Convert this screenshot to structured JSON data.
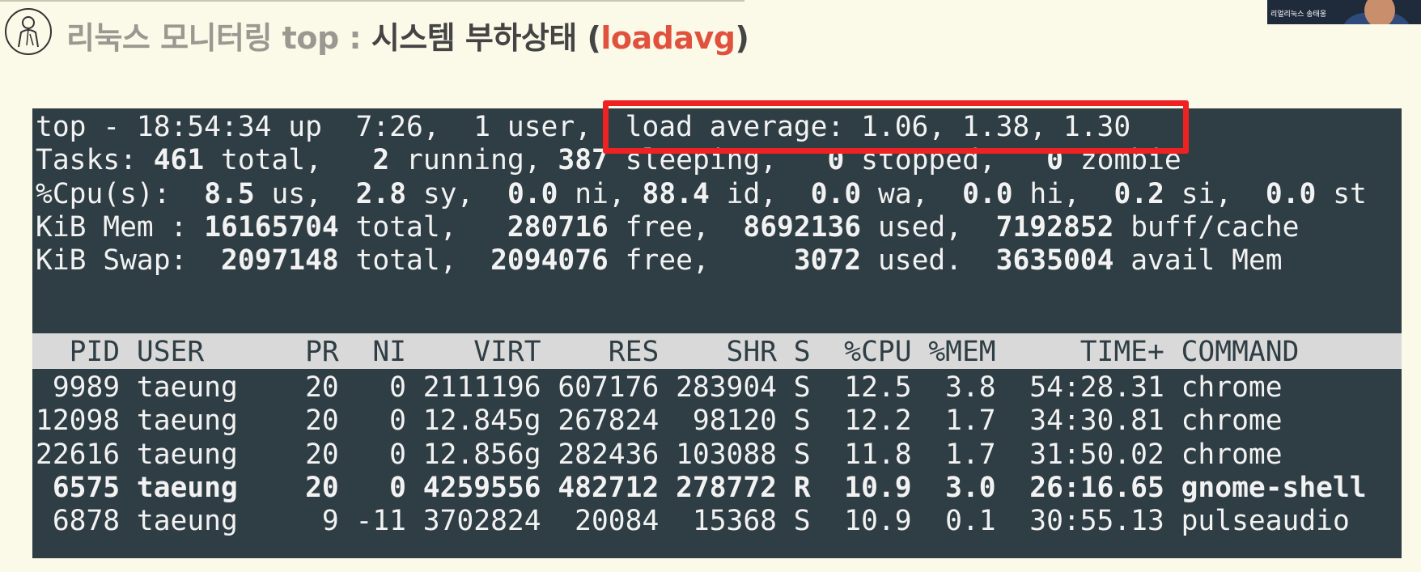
{
  "slide": {
    "title_gray": "리눅스 모니터링 top : ",
    "title_dark": "시스템 부하상태 (",
    "title_red": "loadavg",
    "title_close": ")"
  },
  "webcam": {
    "name": "리얼리눅스 송태웅"
  },
  "colors": {
    "terminal_bg": "#2f3e45",
    "highlight": "#ee2222",
    "accent": "#e0523e",
    "slide_bg": "#fbf9e8"
  },
  "terminal": {
    "summary": [
      [
        {
          "t": "top - 18:54:34 up  7:26,  1 user,  load average: 1.06, 1.38, 1.30"
        }
      ],
      [
        {
          "t": "Tasks: "
        },
        {
          "t": "461",
          "b": true
        },
        {
          "t": " total,   "
        },
        {
          "t": "2",
          "b": true
        },
        {
          "t": " running, "
        },
        {
          "t": "387",
          "b": true
        },
        {
          "t": " sleeping,   "
        },
        {
          "t": "0",
          "b": true
        },
        {
          "t": " stopped,   "
        },
        {
          "t": "0",
          "b": true
        },
        {
          "t": " zombie"
        }
      ],
      [
        {
          "t": "%Cpu(s):  "
        },
        {
          "t": "8.5",
          "b": true
        },
        {
          "t": " us,  "
        },
        {
          "t": "2.8",
          "b": true
        },
        {
          "t": " sy,  "
        },
        {
          "t": "0.0",
          "b": true
        },
        {
          "t": " ni, "
        },
        {
          "t": "88.4",
          "b": true
        },
        {
          "t": " id,  "
        },
        {
          "t": "0.0",
          "b": true
        },
        {
          "t": " wa,  "
        },
        {
          "t": "0.0",
          "b": true
        },
        {
          "t": " hi,  "
        },
        {
          "t": "0.2",
          "b": true
        },
        {
          "t": " si,  "
        },
        {
          "t": "0.0",
          "b": true
        },
        {
          "t": " st"
        }
      ],
      [
        {
          "t": "KiB Mem : "
        },
        {
          "t": "16165704",
          "b": true
        },
        {
          "t": " total,   "
        },
        {
          "t": "280716",
          "b": true
        },
        {
          "t": " free,  "
        },
        {
          "t": "8692136",
          "b": true
        },
        {
          "t": " used,  "
        },
        {
          "t": "7192852",
          "b": true
        },
        {
          "t": " buff/cache"
        }
      ],
      [
        {
          "t": "KiB Swap:  "
        },
        {
          "t": "2097148",
          "b": true
        },
        {
          "t": " total,  "
        },
        {
          "t": "2094076",
          "b": true
        },
        {
          "t": " free,     "
        },
        {
          "t": "3072",
          "b": true
        },
        {
          "t": " used.  "
        },
        {
          "t": "3635004",
          "b": true
        },
        {
          "t": " avail Mem"
        }
      ]
    ],
    "header": "  PID USER      PR  NI    VIRT    RES    SHR S  %CPU %MEM     TIME+ COMMAND",
    "processes": [
      {
        "text": " 9989 taeung    20   0 2111196 607176 283904 S  12.5  3.8  54:28.31 chrome",
        "bold": false
      },
      {
        "text": "12098 taeung    20   0 12.845g 267824  98120 S  12.2  1.7  34:30.81 chrome",
        "bold": false
      },
      {
        "text": "22616 taeung    20   0 12.856g 282436 103088 S  11.8  1.7  31:50.02 chrome",
        "bold": false
      },
      {
        "text": " 6575 taeung    20   0 4259556 482712 278772 R  10.9  3.0  26:16.65 gnome-shell",
        "bold": true
      },
      {
        "text": " 6878 taeung     9 -11 3702824  20084  15368 S  10.9  0.1  30:55.13 pulseaudio",
        "bold": false
      }
    ]
  }
}
